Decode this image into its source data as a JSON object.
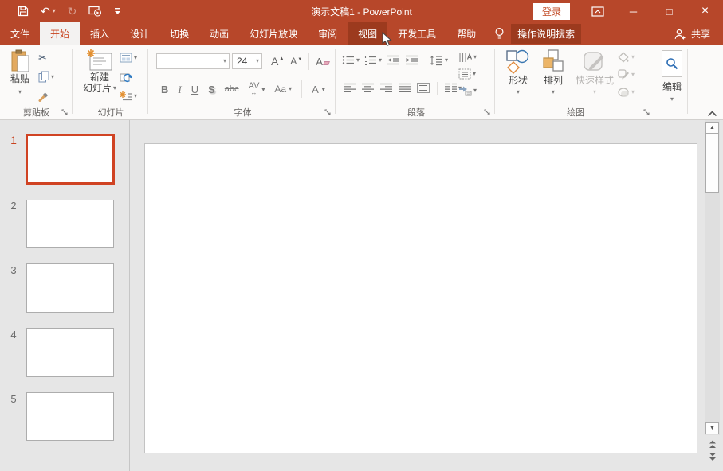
{
  "window": {
    "title": "演示文稿1 - PowerPoint",
    "signin_label": "登录",
    "minimize_glyph": "─",
    "maximize_glyph": "□",
    "close_glyph": "×"
  },
  "icons": {
    "save": "floppy-disk",
    "undo_glyph": "↶",
    "redo_glyph": "↻",
    "start_from_beginning": "slideshow-play",
    "customize_qat": "bar-with-chevron",
    "dropdown_glyph": "▾",
    "scissors_glyph": "✂",
    "scroll_up_glyph": "▲",
    "scroll_down_glyph": "▼"
  },
  "tabs": [
    {
      "label": "文件",
      "state": "normal"
    },
    {
      "label": "开始",
      "state": "selected"
    },
    {
      "label": "插入",
      "state": "normal"
    },
    {
      "label": "设计",
      "state": "normal"
    },
    {
      "label": "切换",
      "state": "normal"
    },
    {
      "label": "动画",
      "state": "normal"
    },
    {
      "label": "幻灯片放映",
      "state": "normal"
    },
    {
      "label": "审阅",
      "state": "normal"
    },
    {
      "label": "视图",
      "state": "hovered"
    },
    {
      "label": "开发工具",
      "state": "normal"
    },
    {
      "label": "帮助",
      "state": "normal"
    }
  ],
  "tellme": {
    "label": "操作说明搜索"
  },
  "share": {
    "label": "共享"
  },
  "ribbon": {
    "clipboard": {
      "group_label": "剪贴板",
      "paste_label": "粘贴"
    },
    "slides": {
      "group_label": "幻灯片",
      "new_slide_line1": "新建",
      "new_slide_line2": "幻灯片"
    },
    "font": {
      "group_label": "字体",
      "font_name_value": "",
      "font_size_value": "24",
      "bold_label": "B",
      "italic_label": "I",
      "underline_label": "U",
      "shadow_label": "S",
      "strikethrough_label": "abc",
      "spacing_label": "AV",
      "spacing_arrow_glyph": "↔",
      "case_label": "Aa",
      "color_label": "A"
    },
    "paragraph": {
      "group_label": "段落"
    },
    "drawing": {
      "group_label": "绘图",
      "shapes_label": "形状",
      "arrange_label": "排列",
      "quick_styles_label": "快速样式"
    },
    "editing": {
      "button_label": "编辑"
    }
  },
  "slide_panel": {
    "slides": [
      {
        "number": "1",
        "selected": true
      },
      {
        "number": "2",
        "selected": false
      },
      {
        "number": "3",
        "selected": false
      },
      {
        "number": "4",
        "selected": false
      },
      {
        "number": "5",
        "selected": false
      }
    ]
  },
  "colors": {
    "accent": "#b7472a",
    "tab_hover_bg": "#9c3a1e",
    "selected_tab_text": "#c8431f",
    "selected_slide_border": "#d04323",
    "ribbon_bg": "#fbfaf9",
    "content_bg": "#e6e6e6"
  }
}
